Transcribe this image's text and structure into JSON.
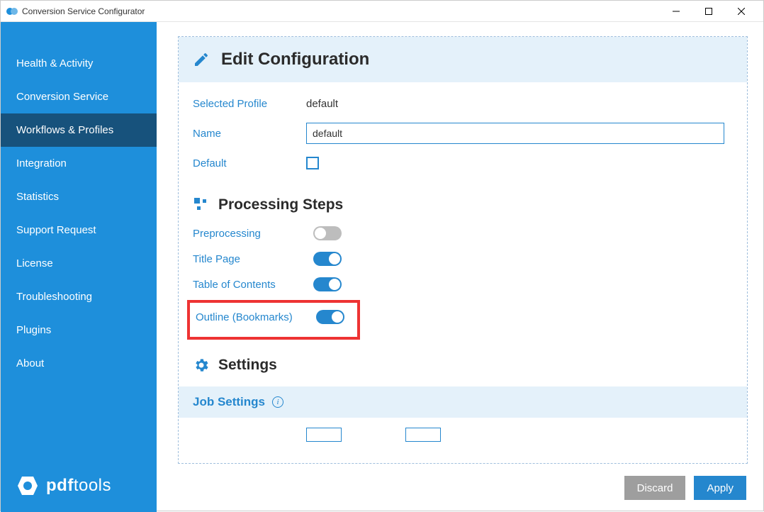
{
  "window": {
    "title": "Conversion Service Configurator"
  },
  "sidebar": {
    "items": [
      {
        "label": "Health & Activity"
      },
      {
        "label": "Conversion Service"
      },
      {
        "label": "Workflows & Profiles"
      },
      {
        "label": "Integration"
      },
      {
        "label": "Statistics"
      },
      {
        "label": "Support Request"
      },
      {
        "label": "License"
      },
      {
        "label": "Troubleshooting"
      },
      {
        "label": "Plugins"
      },
      {
        "label": "About"
      }
    ],
    "selected_index": 2,
    "brand_primary": "pdf",
    "brand_secondary": "tools"
  },
  "panel": {
    "title": "Edit Configuration",
    "fields": {
      "selected_profile_label": "Selected Profile",
      "selected_profile_value": "default",
      "name_label": "Name",
      "name_value": "default",
      "default_label": "Default",
      "default_checked": false
    },
    "processing": {
      "heading": "Processing Steps",
      "steps": [
        {
          "label": "Preprocessing",
          "on": false
        },
        {
          "label": "Title Page",
          "on": true
        },
        {
          "label": "Table of Contents",
          "on": true
        },
        {
          "label": "Outline (Bookmarks)",
          "on": true,
          "highlighted": true
        }
      ]
    },
    "settings": {
      "heading": "Settings",
      "subsection": "Job Settings"
    }
  },
  "footer": {
    "discard": "Discard",
    "apply": "Apply"
  }
}
